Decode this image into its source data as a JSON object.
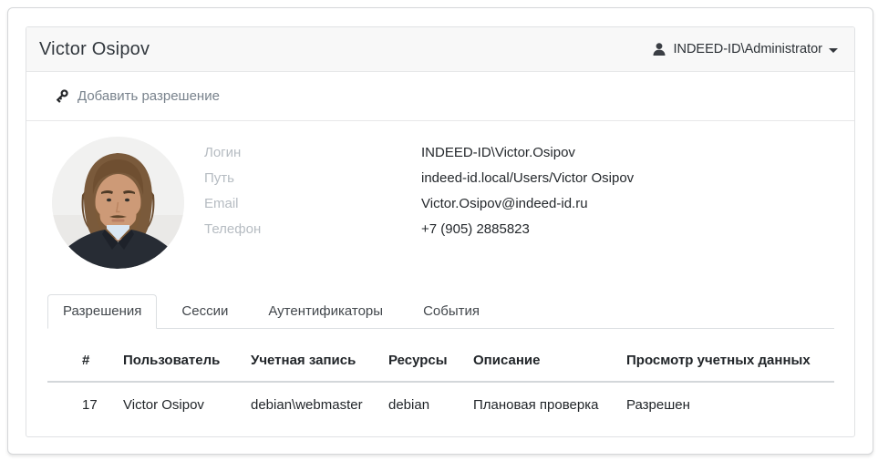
{
  "header": {
    "title": "Victor Osipov",
    "user_menu": {
      "label": "INDEED-ID\\Administrator",
      "icon": "user-icon",
      "caret_icon": "caret-down-icon"
    }
  },
  "toolbar": {
    "add_permission_label": "Добавить разрешение",
    "icon": "key-icon"
  },
  "profile": {
    "avatar": "photo of Victor Osipov, man with brown hair and beard in dark suit",
    "fields": [
      {
        "label": "Логин",
        "value": "INDEED-ID\\Victor.Osipov"
      },
      {
        "label": "Путь",
        "value": "indeed-id.local/Users/Victor Osipov"
      },
      {
        "label": "Email",
        "value": "Victor.Osipov@indeed-id.ru"
      },
      {
        "label": "Телефон",
        "value": "+7 (905) 2885823"
      }
    ]
  },
  "tabs": [
    {
      "label": "Разрешения",
      "active": true
    },
    {
      "label": "Сессии",
      "active": false
    },
    {
      "label": "Аутентификаторы",
      "active": false
    },
    {
      "label": "События",
      "active": false
    }
  ],
  "table": {
    "columns": [
      "#",
      "Пользователь",
      "Учетная запись",
      "Ресурсы",
      "Описание",
      "Просмотр учетных данных"
    ],
    "rows": [
      [
        "17",
        "Victor Osipov",
        "debian\\webmaster",
        "debian",
        "Плановая проверка",
        "Разрешен"
      ]
    ]
  },
  "colors": {
    "header_band_bg": "#f8f8f8",
    "border": "#e0e2e4",
    "tab_border": "#dcdfe2",
    "muted_label": "#b6bcc2",
    "toolbar_link": "#78828c",
    "text_dark": "#24282c"
  }
}
